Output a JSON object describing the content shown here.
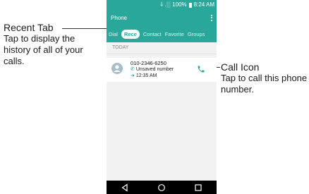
{
  "callouts": {
    "recent_tab": {
      "title": "Recent Tab",
      "body": "Tap to display the history of all of your calls."
    },
    "call_icon": {
      "title": "Call Icon",
      "body": "Tap to call this phone number."
    }
  },
  "status_bar": {
    "signal_icons": "⸸ .░",
    "battery": "100%",
    "time": "8:24 AM"
  },
  "app": {
    "title": "Phone"
  },
  "tabs": [
    {
      "label": "Dial"
    },
    {
      "label": "Rece",
      "active": true
    },
    {
      "label": "Contact"
    },
    {
      "label": "Favorite"
    },
    {
      "label": "Groups"
    }
  ],
  "section": {
    "label": "TODAY"
  },
  "recent_entry": {
    "number": "010-2346-6250",
    "type": "Unsaved number",
    "time": "12:35 AM"
  },
  "colors": {
    "accent": "#2aa79b"
  },
  "icons": {
    "menu": "overflow-menu-icon",
    "avatar": "contact-avatar-icon",
    "call": "phone-call-icon",
    "back": "back-icon",
    "home": "home-icon",
    "recents": "recents-icon"
  }
}
